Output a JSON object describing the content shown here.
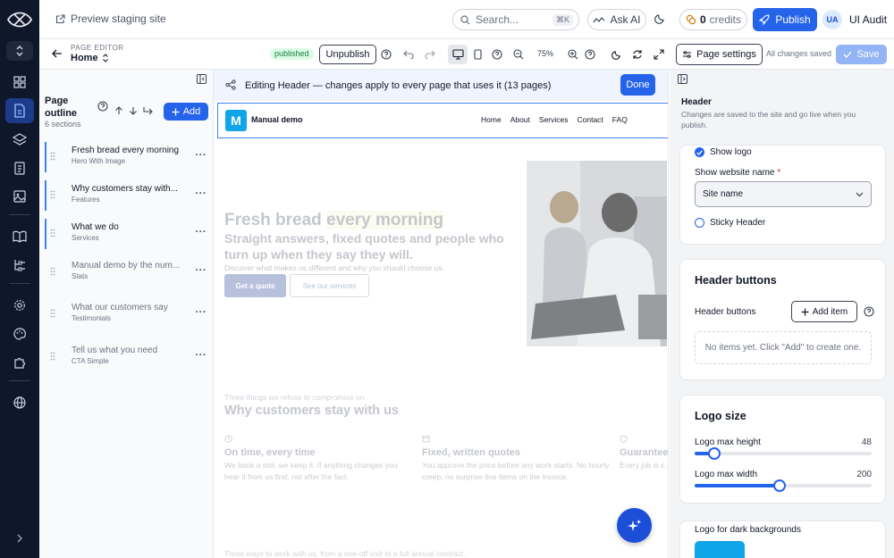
{
  "topbar": {
    "preview_label": "Preview staging site",
    "search_placeholder": "Search...",
    "search_shortcut": "⌘K",
    "ask_ai_label": "Ask AI",
    "credits_count": "0",
    "credits_label": "credits",
    "publish_label": "Publish",
    "user_initials": "UA",
    "user_name": "UI Audit"
  },
  "toolbar": {
    "editor_label": "PAGE EDITOR",
    "page_name": "Home",
    "status_badge": "published",
    "unpublish_label": "Unpublish",
    "zoom": "75%",
    "page_settings_label": "Page settings",
    "saved_status": "All changes saved",
    "save_label": "Save"
  },
  "outline": {
    "title": "Page outline",
    "count": "6 sections",
    "add_label": "Add",
    "sections": [
      {
        "name": "Fresh bread every morning",
        "type": "Hero With Image",
        "active": true
      },
      {
        "name": "Why customers stay with...",
        "type": "Features",
        "active": true
      },
      {
        "name": "What we do",
        "type": "Services",
        "active": true
      },
      {
        "name": "Manual demo by the num...",
        "type": "Stats",
        "active": false
      },
      {
        "name": "What our customers say",
        "type": "Testimonials",
        "active": false
      },
      {
        "name": "Tell us what you need",
        "type": "CTA Simple",
        "active": false
      }
    ]
  },
  "canvas": {
    "banner_text": "Editing Header — changes apply to every page that uses it (13 pages)",
    "done_label": "Done",
    "site": {
      "logo_letter": "M",
      "name": "Manual demo",
      "nav": [
        "Home",
        "About",
        "Services",
        "Contact",
        "FAQ"
      ]
    },
    "hero": {
      "title_part1": "Fresh bread",
      "title_part2": "every morning",
      "subtitle": "Straight answers, fixed quotes and people who turn up when they say they will.",
      "description": "Discover what makes us different and why you should choose us.",
      "cta_primary": "Get a quote",
      "cta_secondary": "See our services"
    },
    "features": {
      "eyebrow": "Three things we refuse to compromise on.",
      "title": "Why customers stay with us",
      "items": [
        {
          "title": "On time, every time",
          "text": "We book a slot, we keep it. If anything changes you hear it from us first, not after the fact."
        },
        {
          "title": "Fixed, written quotes",
          "text": "You approve the price before any work starts. No hourly creep, no surprise line items on the invoice."
        },
        {
          "title": "Guarantee",
          "text": "Every job is c... is not right, w..."
        }
      ]
    },
    "bottom_line": "Three ways to work with us, from a one-off visit to a full annual contract."
  },
  "settings": {
    "title": "Header",
    "subtitle": "Changes are saved to the site and go live when you publish.",
    "show_logo_label": "Show logo",
    "show_website_name_label": "Show website name",
    "required_mark": "*",
    "website_name_value": "Site name",
    "sticky_header_label": "Sticky Header",
    "header_buttons_heading": "Header buttons",
    "header_buttons_label": "Header buttons",
    "add_item_label": "Add item",
    "empty_text": "No items yet. Click \"Add\" to create one.",
    "logo_size_heading": "Logo size",
    "logo_max_height_label": "Logo max height",
    "logo_max_height_value": "48",
    "logo_max_height_fraction": 0.11,
    "logo_max_width_label": "Logo max width",
    "logo_max_width_value": "200",
    "logo_max_width_fraction": 0.48,
    "dark_logo_label": "Logo for dark backgrounds"
  },
  "colors": {
    "accent": "#2563eb",
    "rail_bg": "#0f172a",
    "published_badge": "#dcfce7",
    "site_logo": "#0ea5e9"
  }
}
